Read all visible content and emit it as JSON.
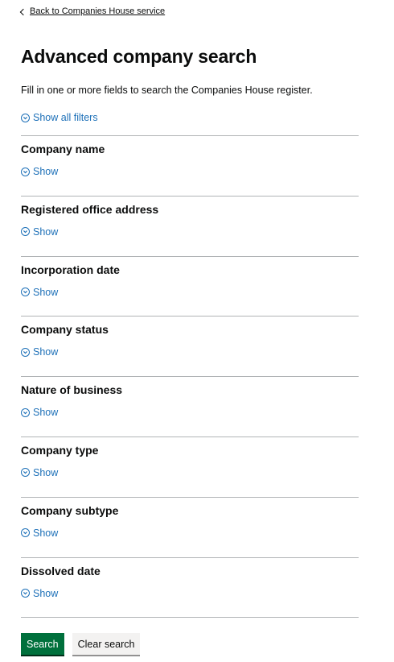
{
  "back_link": {
    "label": "Back to Companies House service"
  },
  "page": {
    "title": "Advanced company search",
    "intro": "Fill in one or more fields to search the Companies House register."
  },
  "show_all_filters": {
    "label": "Show all filters"
  },
  "filters": [
    {
      "title": "Company name",
      "toggle_label": "Show"
    },
    {
      "title": "Registered office address",
      "toggle_label": "Show"
    },
    {
      "title": "Incorporation date",
      "toggle_label": "Show"
    },
    {
      "title": "Company status",
      "toggle_label": "Show"
    },
    {
      "title": "Nature of business",
      "toggle_label": "Show"
    },
    {
      "title": "Company type",
      "toggle_label": "Show"
    },
    {
      "title": "Company subtype",
      "toggle_label": "Show"
    },
    {
      "title": "Dissolved date",
      "toggle_label": "Show"
    }
  ],
  "actions": {
    "search_label": "Search",
    "clear_label": "Clear search"
  },
  "colors": {
    "link": "#1d70b8",
    "primary_button": "#00703c",
    "secondary_button": "#f3f2f1",
    "divider": "#b1b4b6",
    "text": "#0b0c0c"
  },
  "icons": {
    "back": "chevron-left-icon",
    "expand": "chevron-down-circle-icon"
  }
}
